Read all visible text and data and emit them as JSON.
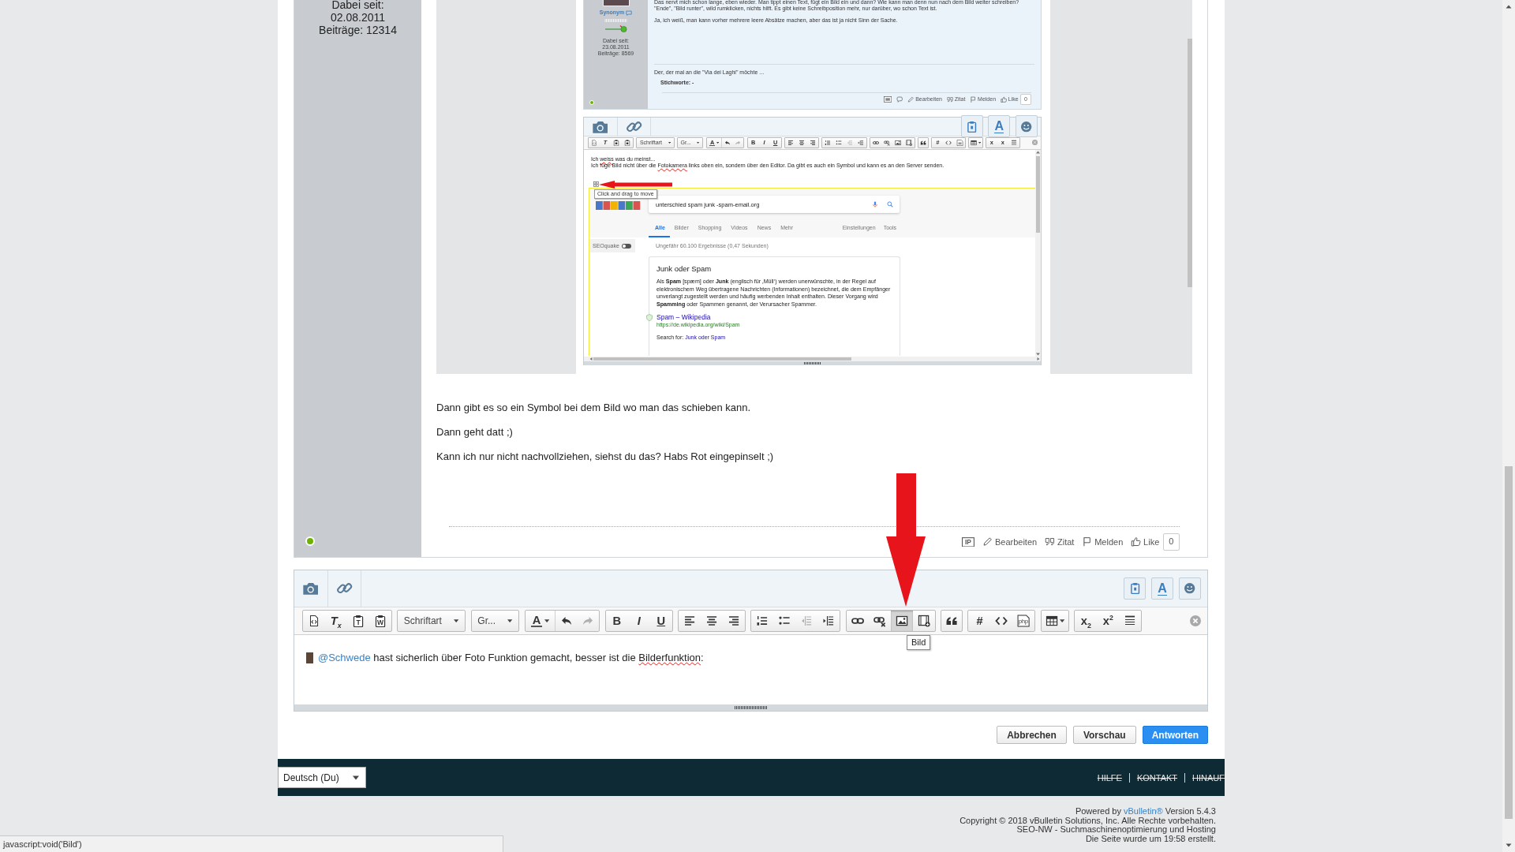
{
  "post": {
    "user_meta": [
      "Dabei seit:",
      "02.08.2011",
      "Beiträge: 12314"
    ],
    "online": true,
    "attachment": {
      "post": {
        "username": "Synonym",
        "user_meta": [
          "Dabei seit:",
          "23.08.2011",
          "Beiträge: 8569"
        ],
        "online": true,
        "lines": [
          "Das nervt mich schon lange, eben wieder. Man tippt einen Text, fügt ein Bild ein und dann? Wie kann man denn nun nach dem Bild weiter schreiben?",
          "\"Ende\", \"Bild runter\", wild rumklicken, nichts hilft. Es gibt keine Schreibposition mehr, nur darüber, wo schon Text ist.",
          "Ja, ich weiß, man kann vorher mehrere leere Absätze machen, aber das ist ja nicht Sinn der Sache."
        ],
        "signature": "Der, der mal an die \"Via dei Laghi\" möchte ...",
        "tags": "Stichworte: -",
        "actions": [
          {
            "kind": "ip"
          },
          {
            "kind": "comment"
          },
          {
            "kind": "edit",
            "label": "Bearbeiten"
          },
          {
            "kind": "quote",
            "label": "Zitat"
          },
          {
            "kind": "report",
            "label": "Melden"
          },
          {
            "kind": "like",
            "label": "Like"
          }
        ],
        "like_count": "0"
      },
      "editor": {
        "top_left": [
          {
            "kind": "camera"
          },
          {
            "kind": "link"
          }
        ],
        "top_right": [
          {
            "kind": "clipboard"
          },
          {
            "kind": "textstyle",
            "glyph": "A"
          },
          {
            "kind": "smiley"
          }
        ],
        "toolbar": [
          [
            {
              "kind": "source",
              "disabled": false
            },
            {
              "kind": "removeformat",
              "glyph": "T",
              "disabled": false
            },
            {
              "kind": "pastetext",
              "disabled": false
            },
            {
              "kind": "pasteword",
              "disabled": false
            }
          ],
          [
            {
              "kind": "dropdown",
              "label": "Schriftart",
              "disabled": false
            }
          ],
          [
            {
              "kind": "dropdown",
              "label": "Gr...",
              "disabled": false
            }
          ],
          [
            {
              "kind": "color",
              "glyph": "A",
              "disabled": false
            },
            {
              "kind": "undo",
              "disabled": false
            },
            {
              "kind": "redo",
              "disabled": true
            }
          ],
          [
            {
              "kind": "bold",
              "glyph": "B",
              "disabled": false
            },
            {
              "kind": "italic",
              "glyph": "I",
              "disabled": false
            },
            {
              "kind": "underline",
              "glyph": "U",
              "disabled": false
            }
          ],
          [
            {
              "kind": "alignleft",
              "disabled": false
            },
            {
              "kind": "aligncenter",
              "disabled": false
            },
            {
              "kind": "alignright",
              "disabled": false
            }
          ],
          [
            {
              "kind": "numbered",
              "disabled": false
            },
            {
              "kind": "bulleted",
              "disabled": false
            },
            {
              "kind": "outdent",
              "disabled": true
            },
            {
              "kind": "indent",
              "disabled": false
            }
          ],
          [
            {
              "kind": "link",
              "disabled": false
            },
            {
              "kind": "unlink",
              "disabled": false
            },
            {
              "kind": "image",
              "disabled": false
            },
            {
              "kind": "video",
              "disabled": false
            }
          ],
          [
            {
              "kind": "quote",
              "disabled": false
            }
          ],
          [
            {
              "kind": "hashtag",
              "glyph": "#",
              "disabled": false
            },
            {
              "kind": "code",
              "disabled": false
            },
            {
              "kind": "php",
              "disabled": false
            }
          ],
          [
            {
              "kind": "table",
              "disabled": false
            }
          ],
          [
            {
              "kind": "subscript",
              "glyph": "x",
              "disabled": false
            },
            {
              "kind": "superscript",
              "glyph": "x",
              "disabled": false
            },
            {
              "kind": "rule",
              "disabled": false
            }
          ]
        ],
        "lines": [
          [
            {
              "kind": "text",
              "text": "Ich "
            },
            {
              "kind": "misspelled",
              "text": "weiss"
            },
            {
              "kind": "text",
              "text": " was du meinst..."
            }
          ],
          [
            {
              "kind": "text",
              "text": "Ich füge Bild nicht über die "
            },
            {
              "kind": "misspelled",
              "text": "Fotokamera"
            },
            {
              "kind": "text",
              "text": " links oben ein, sondern über den Editor. Da gibt es auch ein Symbol und kann es an den Server senden."
            }
          ]
        ],
        "drag_tooltip": "Click and drag to move",
        "image": {
          "query": "unterschied spam junk -spam-email.org",
          "tabs": [
            {
              "label": "Alle",
              "selected": true
            },
            {
              "label": "Bilder",
              "selected": false
            },
            {
              "label": "Shopping",
              "selected": false
            },
            {
              "label": "Videos",
              "selected": false
            },
            {
              "label": "News",
              "selected": false
            },
            {
              "label": "Mehr",
              "selected": false
            }
          ],
          "tools": [
            "Einstellungen",
            "Tools"
          ],
          "toggle": {
            "label": "SEOquake",
            "on": false
          },
          "stats": "Ungefähr 60.100 Ergebnisse (0,47 Sekunden)",
          "card": {
            "title": "Junk oder Spam",
            "text": "Als **Spam** [spæm] oder **Junk** (englisch für ‚Müll‘) werden unerwünschte, in der Regel auf elektronischem Weg übertragene Nachrichten (Informationen) bezeichnet, die dem Empfänger unverlangt zugestellt werden und häufig werbenden Inhalt enthalten. Dieser Vorgang wird **Spamming** oder Spammen genannt, der Verursacher Spammer.",
            "link": "Spam – Wikipedia",
            "url": "https://de.wikipedia.org/wiki/Spam",
            "search_for": [
              {
                "kind": "text",
                "text": "Search for: "
              },
              {
                "kind": "link",
                "text": "Junk oder Spam"
              }
            ]
          }
        }
      }
    },
    "paragraphs": [
      "Dann gibt es so ein Symbol bei dem Bild wo man das schieben kann.",
      "Dann geht datt ;)",
      "Kann ich nur nicht nachvollziehen, siehst du das? Habs Rot eingepinselt ;)"
    ],
    "actions": [
      {
        "kind": "ip",
        "glyph": "IP"
      },
      {
        "kind": "edit",
        "label": "Bearbeiten"
      },
      {
        "kind": "quote",
        "label": "Zitat"
      },
      {
        "kind": "report",
        "label": "Melden"
      },
      {
        "kind": "like",
        "label": "Like"
      }
    ],
    "like_count": "0"
  },
  "editor": {
    "top_left": [
      {
        "kind": "camera"
      },
      {
        "kind": "link"
      }
    ],
    "top_right": [
      {
        "kind": "clipboard"
      },
      {
        "kind": "textstyle",
        "glyph": "A"
      },
      {
        "kind": "smiley"
      }
    ],
    "toolbar": [
      [
        {
          "kind": "source",
          "disabled": false,
          "highlighted": false
        },
        {
          "kind": "removeformat",
          "glyph": "T$_{x}$",
          "disabled": false,
          "highlighted": false
        },
        {
          "kind": "pastetext",
          "glyph": "T",
          "disabled": false,
          "highlighted": false
        },
        {
          "kind": "pasteword",
          "glyph": "W",
          "disabled": false,
          "highlighted": false
        }
      ],
      [
        {
          "kind": "dropdown",
          "label": "Schriftart",
          "disabled": false,
          "highlighted": false
        }
      ],
      [
        {
          "kind": "dropdown",
          "label": "Gr...",
          "disabled": false,
          "highlighted": false
        }
      ],
      [
        {
          "kind": "color",
          "glyph": "A",
          "disabled": false,
          "highlighted": false
        },
        {
          "kind": "undo",
          "disabled": false,
          "highlighted": false
        },
        {
          "kind": "redo",
          "disabled": true,
          "highlighted": false
        }
      ],
      [
        {
          "kind": "bold",
          "glyph": "B",
          "disabled": false,
          "highlighted": false
        },
        {
          "kind": "italic",
          "glyph": "I",
          "disabled": false,
          "highlighted": false
        },
        {
          "kind": "underline",
          "glyph": "U",
          "disabled": false,
          "highlighted": false
        }
      ],
      [
        {
          "kind": "alignleft",
          "disabled": false,
          "highlighted": false
        },
        {
          "kind": "aligncenter",
          "disabled": false,
          "highlighted": false
        },
        {
          "kind": "alignright",
          "disabled": false,
          "highlighted": false
        }
      ],
      [
        {
          "kind": "numbered",
          "disabled": false,
          "highlighted": false
        },
        {
          "kind": "bulleted",
          "disabled": false,
          "highlighted": false
        },
        {
          "kind": "outdent",
          "disabled": true,
          "highlighted": false
        },
        {
          "kind": "indent",
          "disabled": false,
          "highlighted": false
        }
      ],
      [
        {
          "kind": "link",
          "disabled": false,
          "highlighted": false
        },
        {
          "kind": "unlink",
          "disabled": false,
          "highlighted": false
        },
        {
          "kind": "image",
          "disabled": false,
          "highlighted": true
        },
        {
          "kind": "video",
          "disabled": false,
          "highlighted": false
        }
      ],
      [
        {
          "kind": "quote",
          "disabled": false,
          "highlighted": false
        }
      ],
      [
        {
          "kind": "hashtag",
          "glyph": "#",
          "disabled": false,
          "highlighted": false
        },
        {
          "kind": "code",
          "disabled": false,
          "highlighted": false
        },
        {
          "kind": "php",
          "glyph": "php",
          "disabled": false,
          "highlighted": false
        }
      ],
      [
        {
          "kind": "table",
          "disabled": false,
          "highlighted": false
        }
      ],
      [
        {
          "kind": "subscript",
          "glyph": "x$_{2}$",
          "disabled": false,
          "highlighted": false
        },
        {
          "kind": "superscript",
          "glyph": "x$^{2}$",
          "disabled": false,
          "highlighted": false
        },
        {
          "kind": "rule",
          "disabled": false,
          "highlighted": false
        }
      ]
    ],
    "tooltip": "Bild",
    "content": [
      {
        "kind": "mention",
        "text": "@Schwede"
      },
      {
        "kind": "text",
        "text": " hast sicherlich über Foto Funktion gemacht, besser ist die "
      },
      {
        "kind": "misspelled",
        "text": "Bilderfunktion"
      },
      {
        "kind": "text",
        "text": ":"
      }
    ]
  },
  "buttons": [
    {
      "label": "Abbrechen",
      "kind": "secondary"
    },
    {
      "label": "Vorschau",
      "kind": "secondary"
    },
    {
      "label": "Antworten",
      "kind": "primary"
    }
  ],
  "footer": {
    "language": "Deutsch (Du)",
    "links": [
      "HILFE",
      "KONTAKT",
      "HINAUF"
    ],
    "credits": [
      [
        {
          "kind": "text",
          "text": "Powered by "
        },
        {
          "kind": "link",
          "text": "vBulletin®"
        },
        {
          "kind": "text",
          "text": " Version 5.4.3"
        }
      ],
      [
        {
          "kind": "text",
          "text": "Copyright © 2018 vBulletin Solutions, Inc. Alle Rechte vorbehalten."
        }
      ],
      [
        {
          "kind": "text",
          "text": "SEO-NW - Suchmaschinenoptimierung und Hosting"
        }
      ],
      [
        {
          "kind": "text",
          "text": "Die Seite wurde um 19:58 erstellt."
        }
      ]
    ]
  },
  "status_bar": "javascript:void('Bild')"
}
